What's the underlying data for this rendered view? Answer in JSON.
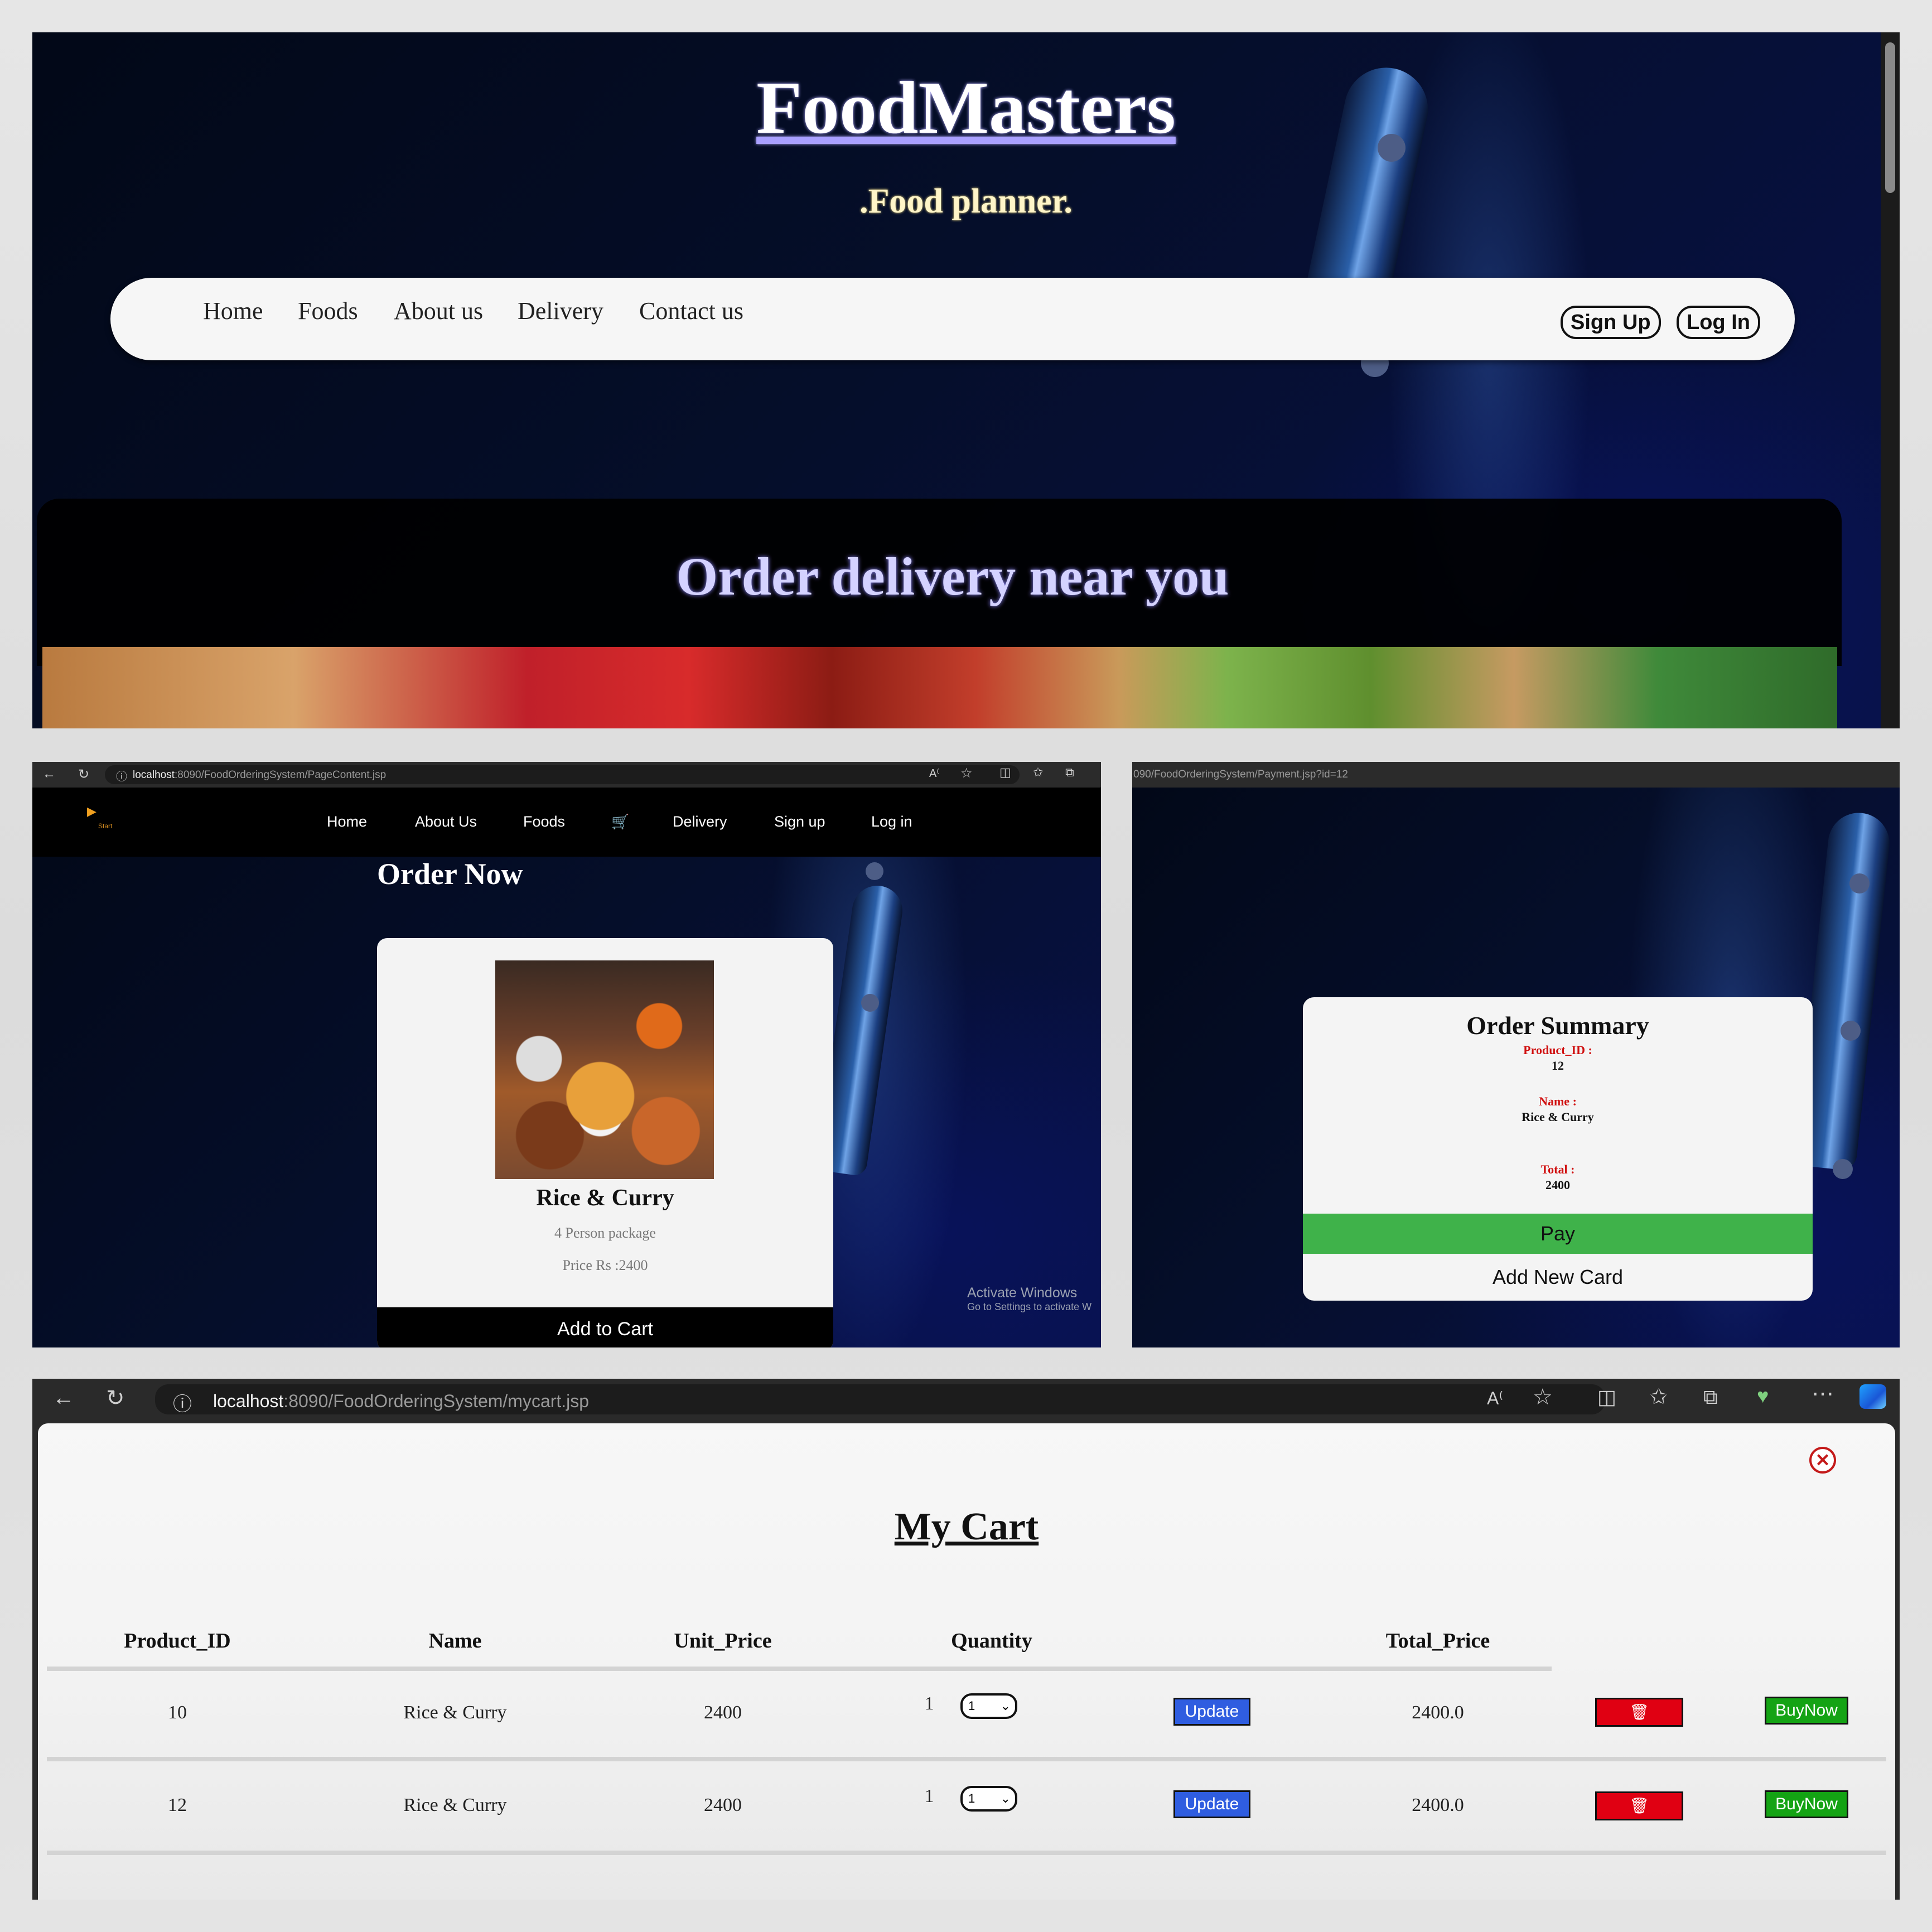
{
  "landing": {
    "brand_title": "FoodMasters",
    "tagline": ".Food planner.",
    "nav_links": [
      "Home",
      "Foods",
      "About us",
      "Delivery",
      "Contact us"
    ],
    "sign_up": "Sign Up",
    "log_in": "Log In",
    "hero_text": "Order delivery near you"
  },
  "order_page": {
    "url_host": "localhost",
    "url_path": ":8090/FoodOrderingSystem/PageContent.jsp",
    "logo_text": "Start",
    "nav_links": [
      "Home",
      "About Us",
      "Foods",
      "Delivery",
      "Sign up",
      "Log in"
    ],
    "heading": "Order Now",
    "product_name": "Rice & Curry",
    "product_desc": "4 Person package",
    "product_price": "Price Rs :2400",
    "add_to_cart": "Add to Cart",
    "watermark_title": "Activate Windows",
    "watermark_sub": "Go to Settings to activate W"
  },
  "payment_page": {
    "url_partial": "090/FoodOrderingSystem/Payment.jsp?id=12",
    "title": "Order Summary",
    "product_id_label": "Product_ID :",
    "product_id": "12",
    "name_label": "Name :",
    "name": "Rice & Curry",
    "total_label": "Total :",
    "total": "2400",
    "pay": "Pay",
    "add_new_card": "Add New Card"
  },
  "cart_page": {
    "url_host": "localhost",
    "url_path": ":8090/FoodOrderingSystem/mycart.jsp",
    "title": "My Cart",
    "columns": [
      "Product_ID",
      "Name",
      "Unit_Price",
      "Quantity",
      "Total_Price"
    ],
    "update_label": "Update",
    "buy_label": "BuyNow",
    "rows": [
      {
        "id": "10",
        "name": "Rice & Curry",
        "unit": "2400",
        "qty": "1",
        "select": "1",
        "total": "2400.0"
      },
      {
        "id": "12",
        "name": "Rice & Curry",
        "unit": "2400",
        "qty": "1",
        "select": "1",
        "total": "2400.0"
      }
    ]
  },
  "colors": {
    "accent_purple": "#d4d2ff",
    "pay_green": "#3fb24a",
    "update_blue": "#2f5de0",
    "delete_red": "#e00012",
    "buy_green": "#14a314",
    "label_red": "#d01010"
  },
  "icons": [
    "back-arrow-icon",
    "refresh-icon",
    "info-icon",
    "read-aloud-icon",
    "star-icon",
    "split-screen-icon",
    "favorites-icon",
    "collections-icon",
    "heartbeat-icon",
    "more-icon",
    "copilot-icon",
    "cart-icon",
    "trash-icon",
    "close-icon",
    "chevron-down-icon"
  ]
}
